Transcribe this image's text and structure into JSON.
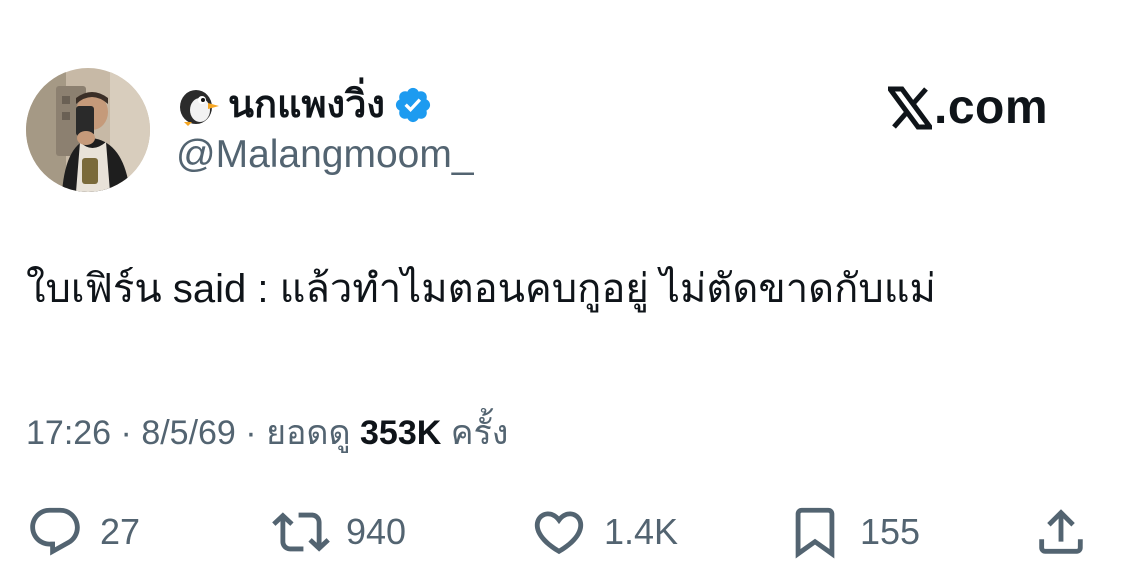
{
  "author": {
    "display_name": "นกแพงวิ่ง",
    "name_emoji": "penguin-emoji",
    "verified": true,
    "verified_color": "#1d9bf0",
    "handle": "@Malangmoom_"
  },
  "brand": {
    "icon": "x-logo-icon",
    "text": ".com"
  },
  "tweet": {
    "text": "ใบเฟิร์น said : แล้วทำไมตอนคบกูอยู่ ไม่ตัดขาดกับแม่"
  },
  "meta": {
    "time": "17:26",
    "separator_1": " · ",
    "date": "8/5/69",
    "separator_2": " · ",
    "views_prefix": "ยอดดู ",
    "views_count": "353K",
    "views_suffix": " ครั้ง"
  },
  "actions": {
    "replies": "27",
    "reposts": "940",
    "likes": "1.4K",
    "bookmarks": "155"
  },
  "colors": {
    "text": "#0f1419",
    "secondary": "#536471",
    "verified": "#1d9bf0"
  }
}
